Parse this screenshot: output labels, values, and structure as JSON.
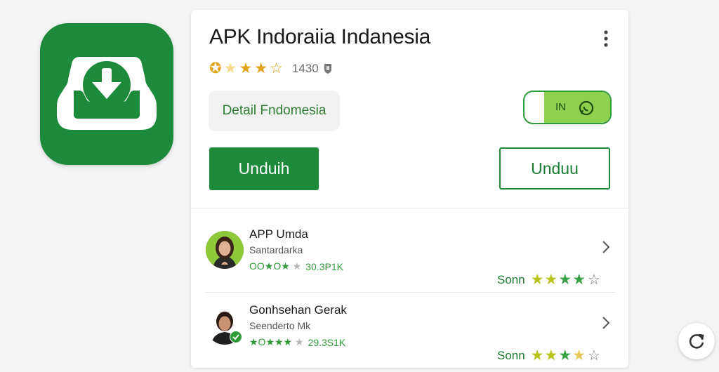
{
  "app": {
    "title": "APK Indoraiia Indanesia",
    "rating_count": "1430",
    "icon": "download-tray-icon"
  },
  "detail_chip": {
    "label": "Detail Fndomesia"
  },
  "toggle": {
    "label": "IN",
    "state": "on",
    "icon": "whatsapp-icon"
  },
  "buttons": {
    "primary_label": "Unduih",
    "secondary_label": "Unduu"
  },
  "list": [
    {
      "name": "APP Umda",
      "subtitle": "Santardarka",
      "mini_stars": "OO★O★",
      "count": "30.3P1K",
      "right_label": "Sonn"
    },
    {
      "name": "Gonhsehan Gerak",
      "subtitle": "Seenderto Mk",
      "mini_stars": "★O★★★",
      "count": "29.3S1K",
      "right_label": "Sonn"
    }
  ],
  "colors": {
    "brand_green": "#1c8a3a",
    "toggle_lime": "#8fd14f",
    "star_gold": "#e2a21b",
    "star_olive": "#b7c21a"
  }
}
